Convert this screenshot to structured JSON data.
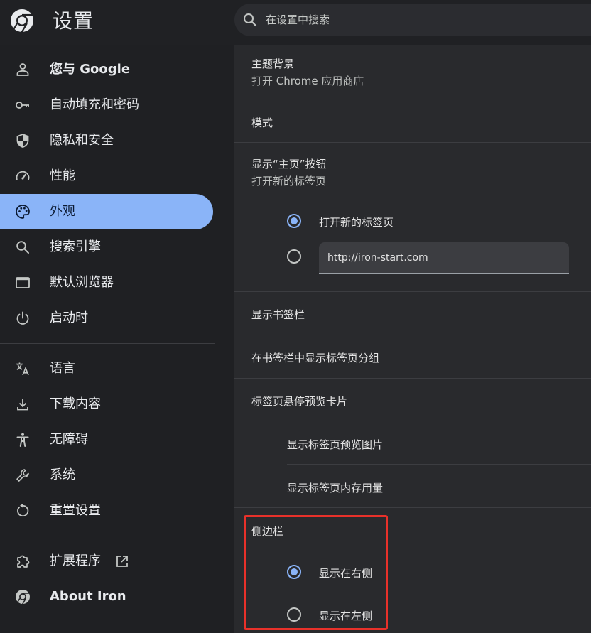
{
  "header": {
    "title": "设置",
    "search_placeholder": "在设置中搜索"
  },
  "sidebar": {
    "items": [
      {
        "label": "您与 Google",
        "icon": "person-icon"
      },
      {
        "label": "自动填充和密码",
        "icon": "key-icon"
      },
      {
        "label": "隐私和安全",
        "icon": "shield-icon"
      },
      {
        "label": "性能",
        "icon": "speedometer-icon"
      },
      {
        "label": "外观",
        "icon": "palette-icon",
        "active": true
      },
      {
        "label": "搜索引擎",
        "icon": "search-icon"
      },
      {
        "label": "默认浏览器",
        "icon": "browser-window-icon"
      },
      {
        "label": "启动时",
        "icon": "power-icon"
      },
      {
        "label": "语言",
        "icon": "translate-icon"
      },
      {
        "label": "下载内容",
        "icon": "download-icon"
      },
      {
        "label": "无障碍",
        "icon": "accessibility-icon"
      },
      {
        "label": "系统",
        "icon": "wrench-icon"
      },
      {
        "label": "重置设置",
        "icon": "reset-icon"
      },
      {
        "label": "扩展程序",
        "icon": "puzzle-icon"
      },
      {
        "label": "About Iron",
        "icon": "chrome-logo-icon"
      }
    ]
  },
  "main": {
    "theme": {
      "title": "主题背景",
      "subtitle": "打开 Chrome 应用商店"
    },
    "mode": {
      "title": "模式"
    },
    "home_button": {
      "title": "显示“主页”按钮",
      "subtitle": "打开新的标签页",
      "option_newtab": "打开新的标签页",
      "url_value": "http://iron-start.com"
    },
    "bookmarks_bar": {
      "title": "显示书签栏"
    },
    "tab_groups": {
      "title": "在书签栏中显示标签页分组"
    },
    "hover_card": {
      "title": "标签页悬停预览卡片",
      "option_preview_image": "显示标签页预览图片",
      "option_memory": "显示标签页内存用量"
    },
    "side_panel": {
      "title": "侧边栏",
      "option_right": "显示在右侧",
      "option_left": "显示在左侧",
      "selected": "显示在右侧"
    }
  },
  "colors": {
    "accent": "#8ab4f8",
    "highlight": "#e8312a",
    "background": "#202124",
    "panel": "#292a2d"
  }
}
